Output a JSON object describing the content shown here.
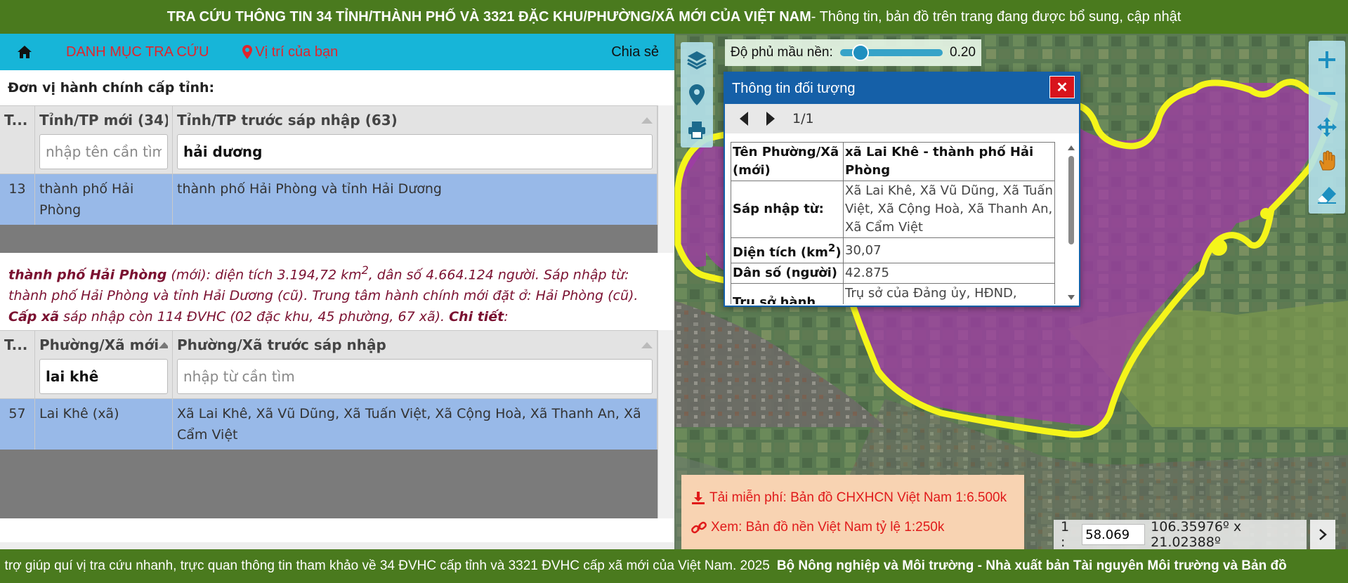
{
  "banner": {
    "title_bold": "TRA CỨU THÔNG TIN 34 TỈNH/THÀNH PHỐ VÀ 3321 ĐẶC KHU/PHƯỜNG/XÃ MỚI CỦA VIỆT NAM",
    "title_rest": " - Thông tin, bản đồ trên trang đang được bổ sung, cập nhật"
  },
  "nav": {
    "menu_label": "DANH MỤC TRA CỨU",
    "location_label": "Vị trí của bạn",
    "share_label": "Chia sẻ"
  },
  "province_section": {
    "title": "Đơn vị hành chính cấp tỉnh:",
    "headers": [
      "T...",
      "Tỉnh/TP mới (34)",
      "Tỉnh/TP trước sáp nhập (63)"
    ],
    "filter_new_placeholder": "nhập tên cần tìm",
    "filter_old_value": "hải dương",
    "rows": [
      {
        "stt": "13",
        "new": "thành phố Hải Phòng",
        "old": "thành phố Hải Phòng và tỉnh Hải Dương"
      }
    ]
  },
  "province_info": {
    "name": "thành phố Hải Phòng",
    "text1": " (mới): diện tích 3.194,72 km",
    "sup": "2",
    "text2": ", dân số 4.664.124 người. Sáp nhập từ: thành phố Hải Phòng và tỉnh Hải Dương (cũ). Trung tâm hành chính mới đặt ở: Hải Phòng (cũ). ",
    "cap_xa": "Cấp xã",
    "text3": " sáp nhập còn 114 ĐVHC (02 đặc khu, 45 phường, 67 xã). ",
    "chi_tiet": "Chi tiết",
    "colon": ":"
  },
  "ward_section": {
    "headers": [
      "T...",
      "Phường/Xã mới",
      "Phường/Xã trước sáp nhập"
    ],
    "filter_new_value": "lai khê",
    "filter_old_placeholder": "nhập từ cần tìm",
    "rows": [
      {
        "stt": "57",
        "new": "Lai Khê (xã)",
        "old": "Xã Lai Khê, Xã Vũ Dũng, Xã Tuấn Việt, Xã Cộng Hoà, Xã Thanh An, Xã Cẩm Việt"
      }
    ]
  },
  "map": {
    "opacity_label": "Độ phủ mầu nền:",
    "opacity_value": "0.20",
    "opacity_fraction": 0.2,
    "popup": {
      "title": "Thông tin đối tượng",
      "close": "✕",
      "pager": "1/1",
      "rows": [
        {
          "key": "Tên Phường/Xã (mới)",
          "value": "xã Lai Khê - thành phố Hải Phòng"
        },
        {
          "key": "Sáp nhập từ:",
          "value": "Xã Lai Khê, Xã Vũ Dũng, Xã Tuấn Việt, Xã Cộng Hoà, Xã Thanh An, Xã Cẩm Việt"
        },
        {
          "key_prefix": "Diện tích (km",
          "key_sup": "2",
          "key_suffix": ")",
          "value": "30,07"
        },
        {
          "key": "Dân số (người)",
          "value": "42.875"
        },
        {
          "key": "Trụ sở hành",
          "value": "Trụ sở của Đảng ủy, HĐND, UBND"
        }
      ]
    },
    "download": {
      "free_map": "Tải miễn phí: Bản đồ CHXHCN Việt Nam 1:6.500k",
      "base_map": "Xem: Bản đồ nền Việt Nam tỷ lệ 1:250k"
    },
    "scale": {
      "prefix": "1 :",
      "value": "58.069",
      "coords": "106.35976º x 21.02388º"
    },
    "icons": {
      "left_toolbar": [
        "layers-icon",
        "map-pin-icon",
        "printer-icon"
      ],
      "right_toolbar": [
        "zoom-in-icon",
        "zoom-out-icon",
        "pan-move-icon",
        "hand-icon",
        "eraser-icon"
      ]
    }
  },
  "footer": {
    "text": "; trợ giúp quí vị tra cứu nhanh, trực quan thông tin tham khảo về 34 ĐVHC cấp tỉnh và 3321 ĐVHC cấp xã mới của Việt Nam. 2025",
    "bold": "Bộ Nông nghiệp và Môi trường - Nhà xuất bản Tài nguyên Môi trường và Bản đồ"
  },
  "colors": {
    "banner_green": "#4a7a1e",
    "nav_cyan": "#17b5d8",
    "row_selected": "#98b9e8",
    "popup_blue": "#1560a8",
    "boundary_yellow": "#f5f51a",
    "area_magenta": "#a23aa8"
  }
}
